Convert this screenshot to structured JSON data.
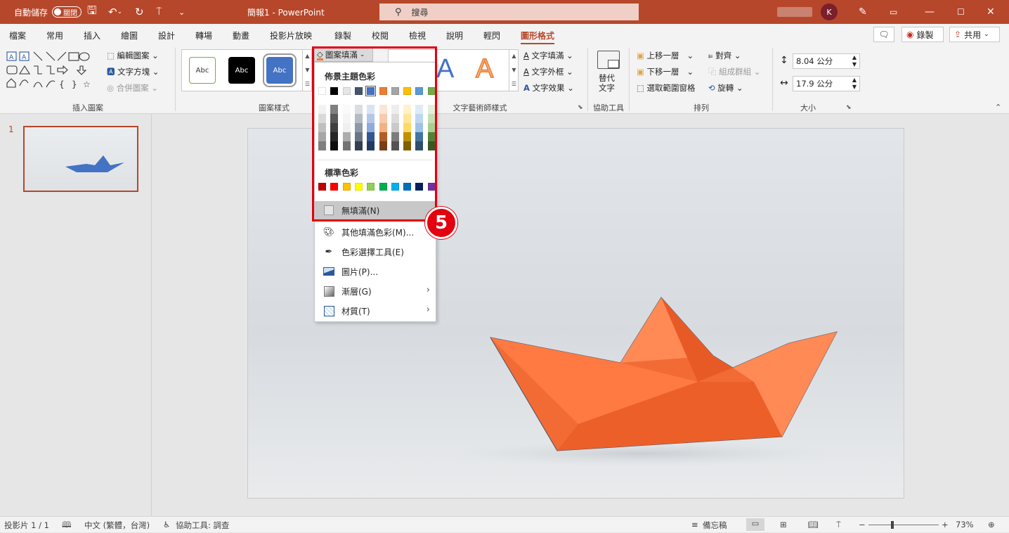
{
  "titlebar": {
    "autosave_label": "自動儲存",
    "autosave_state": "關閉",
    "doc_title": "簡報1 - PowerPoint",
    "search_placeholder": "搜尋",
    "user_initial": "K"
  },
  "tabs": [
    "檔案",
    "常用",
    "插入",
    "繪圖",
    "設計",
    "轉場",
    "動畫",
    "投影片放映",
    "錄製",
    "校閱",
    "檢視",
    "說明",
    "輕閃",
    "圖形格式"
  ],
  "active_tab": "圖形格式",
  "tab_actions": {
    "record": "錄製",
    "share": "共用"
  },
  "ribbon": {
    "insert_shapes": {
      "edit_shape": "編輯圖案",
      "text_box": "文字方塊",
      "merge_shapes": "合併圖案",
      "label": "插入圖案"
    },
    "shape_styles": {
      "samples": [
        "Abc",
        "Abc",
        "Abc"
      ],
      "fill": "圖案填滿",
      "label": "圖案樣式"
    },
    "wordart": {
      "text_fill": "文字填滿",
      "text_outline": "文字外框",
      "text_effects": "文字效果",
      "label": "文字藝術師樣式"
    },
    "accessibility": {
      "alt_text": "替代\n文字",
      "label": "協助工具"
    },
    "arrange": {
      "bring_forward": "上移一層",
      "send_backward": "下移一層",
      "selection_pane": "選取範圍窗格",
      "align": "對齊",
      "group": "組成群組",
      "rotate": "旋轉",
      "label": "排列"
    },
    "size": {
      "height": "8.04 公分",
      "width": "17.9 公分",
      "label": "大小"
    }
  },
  "fill_menu": {
    "theme_colors_title": "佈景主題色彩",
    "standard_colors_title": "標準色彩",
    "theme_colors": [
      "#ffffff",
      "#000000",
      "#e7e6e6",
      "#44546a",
      "#4472c4",
      "#ed7d31",
      "#a5a5a5",
      "#ffc000",
      "#5b9bd5",
      "#70ad47"
    ],
    "standard_colors": [
      "#c00000",
      "#ff0000",
      "#ffc000",
      "#ffff00",
      "#92d050",
      "#00b050",
      "#00b0f0",
      "#0070c0",
      "#002060",
      "#7030a0"
    ],
    "items": [
      {
        "label": "無填滿(N)",
        "icon": "no-fill-icon"
      },
      {
        "label": "其他填滿色彩(M)...",
        "icon": "palette-icon"
      },
      {
        "label": "色彩選擇工具(E)",
        "icon": "eyedropper-icon"
      },
      {
        "label": "圖片(P)...",
        "icon": "picture-icon"
      },
      {
        "label": "漸層(G)",
        "icon": "gradient-icon"
      },
      {
        "label": "材質(T)",
        "icon": "texture-icon"
      }
    ]
  },
  "callout_number": "5",
  "slides": {
    "number": "1"
  },
  "status": {
    "slide_count": "投影片 1 / 1",
    "language": "中文 (繁體，台灣)",
    "accessibility": "協助工具: 調查",
    "notes": "備忘稿",
    "zoom": "73%"
  }
}
